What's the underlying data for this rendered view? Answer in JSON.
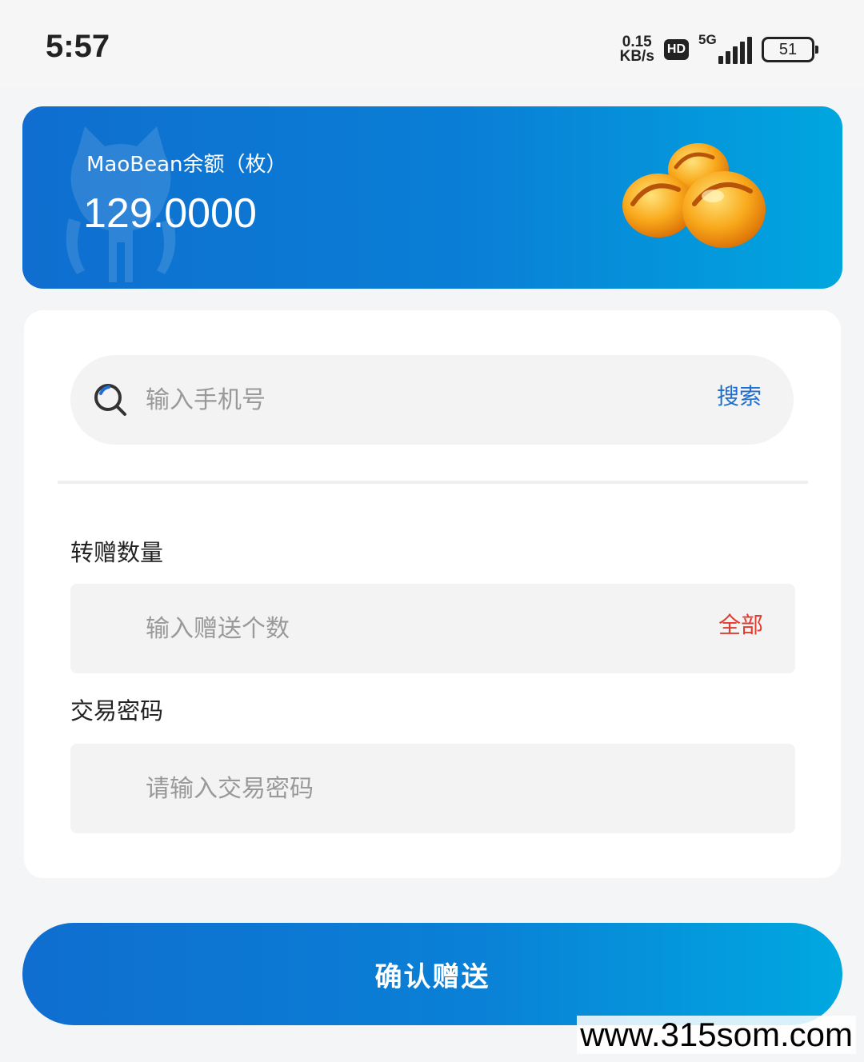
{
  "status_bar": {
    "time": "5:57",
    "net_speed_value": "0.15",
    "net_speed_unit": "KB/s",
    "hd_label": "HD",
    "network_label": "5G",
    "battery_level": "51"
  },
  "balance": {
    "label": "MaoBean余额（枚）",
    "value": "129.0000"
  },
  "search": {
    "placeholder": "输入手机号",
    "button_label": "搜索"
  },
  "transfer_amount": {
    "label": "转赠数量",
    "placeholder": "输入赠送个数",
    "all_button_label": "全部"
  },
  "trade_password": {
    "label": "交易密码",
    "placeholder": "请输入交易密码"
  },
  "confirm_button_label": "确认赠送",
  "site_watermark": "www.315som.com",
  "colors": {
    "brand_blue": "#0f6ecf",
    "brand_cyan": "#00a6df",
    "link_blue": "#1f6fd0",
    "accent_red": "#e23b2e"
  }
}
